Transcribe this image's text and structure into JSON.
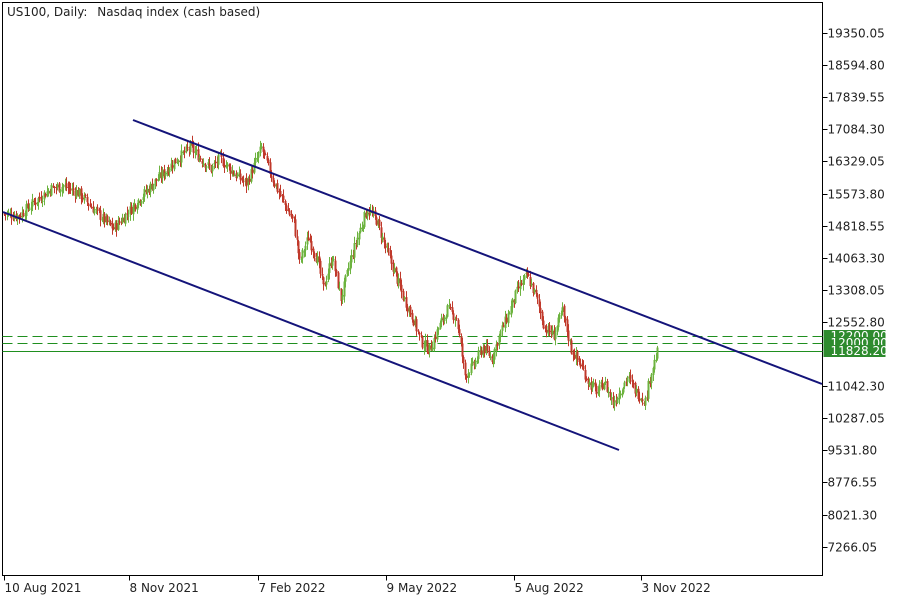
{
  "header": {
    "symbol": "US100, Daily:",
    "description": "Nasdaq index (cash based)"
  },
  "colors": {
    "bull": "#6db33f",
    "bear": "#c0392b",
    "trendline": "#14147a",
    "level_line": "#1f8f1f",
    "price_tag_bg": "#2e8b2e",
    "price_tag_text": "#ffffff",
    "axis_text": "#222222",
    "frame": "#000000"
  },
  "chart_data": {
    "type": "candlestick",
    "x_tick_labels": [
      "10 Aug 2021",
      "8 Nov 2021",
      "7 Feb 2022",
      "9 May 2022",
      "5 Aug 2022",
      "3 Nov 2022"
    ],
    "y_tick_labels": [
      "19350.05",
      "18594.80",
      "17839.55",
      "17084.30",
      "16329.05",
      "15573.80",
      "14818.55",
      "14063.30",
      "13308.05",
      "12552.80",
      "11042.30",
      "10287.05",
      "9531.80",
      "8776.55",
      "8021.30",
      "7266.05"
    ],
    "y_ticks": [
      19350.05,
      18594.8,
      17839.55,
      17084.3,
      16329.05,
      15573.8,
      14818.55,
      14063.3,
      13308.05,
      12552.8,
      11042.3,
      10287.05,
      9531.8,
      8776.55,
      8021.3,
      7266.05
    ],
    "ylim": [
      6620,
      20110
    ],
    "levels": [
      {
        "value": 12200.0,
        "label": "12200.00",
        "style": "dashed"
      },
      {
        "value": 12000.0,
        "label": "12000.00",
        "style": "dashed"
      },
      {
        "value": 11828.2,
        "label": "11828.20",
        "style": "solid"
      }
    ],
    "trendlines": [
      {
        "name": "upper-channel-line",
        "points": [
          [
            "Sep 2021",
            17300
          ],
          [
            "Jan 2023",
            11030
          ]
        ]
      },
      {
        "name": "lower-channel-line",
        "points": [
          [
            "Aug 2021",
            15170
          ],
          [
            "Oct 2022",
            9470
          ]
        ]
      }
    ],
    "close_path": [
      [
        15100,
        1
      ],
      [
        15050,
        10
      ],
      [
        15300,
        8
      ],
      [
        15700,
        14
      ],
      [
        15750,
        8
      ],
      [
        15600,
        10
      ],
      [
        15150,
        12
      ],
      [
        14750,
        12
      ],
      [
        15300,
        14
      ],
      [
        15850,
        14
      ],
      [
        16350,
        14
      ],
      [
        16650,
        10
      ],
      [
        16150,
        14
      ],
      [
        16400,
        6
      ],
      [
        16100,
        8
      ],
      [
        15800,
        10
      ],
      [
        16650,
        10
      ],
      [
        15900,
        8
      ],
      [
        15300,
        8
      ],
      [
        14900,
        6
      ],
      [
        13950,
        4
      ],
      [
        14550,
        6
      ],
      [
        14000,
        6
      ],
      [
        13350,
        4
      ],
      [
        14100,
        6
      ],
      [
        13100,
        6
      ],
      [
        13950,
        6
      ],
      [
        14650,
        6
      ],
      [
        15200,
        6
      ],
      [
        14950,
        6
      ],
      [
        14300,
        6
      ],
      [
        13750,
        6
      ],
      [
        13150,
        6
      ],
      [
        12700,
        6
      ],
      [
        12100,
        6
      ],
      [
        11900,
        6
      ],
      [
        12400,
        6
      ],
      [
        12850,
        6
      ],
      [
        12650,
        6
      ],
      [
        11300,
        6
      ],
      [
        11550,
        6
      ],
      [
        11950,
        6
      ],
      [
        11700,
        6
      ],
      [
        12300,
        6
      ],
      [
        12800,
        6
      ],
      [
        13350,
        6
      ],
      [
        13650,
        6
      ],
      [
        13150,
        6
      ],
      [
        12400,
        6
      ],
      [
        12250,
        6
      ],
      [
        12800,
        6
      ],
      [
        11900,
        6
      ],
      [
        11550,
        6
      ],
      [
        11100,
        6
      ],
      [
        10900,
        6
      ],
      [
        11150,
        4
      ],
      [
        10650,
        6
      ],
      [
        11000,
        6
      ],
      [
        11250,
        4
      ],
      [
        10900,
        6
      ],
      [
        10700,
        6
      ],
      [
        11400,
        4
      ],
      [
        11830,
        4
      ]
    ]
  }
}
